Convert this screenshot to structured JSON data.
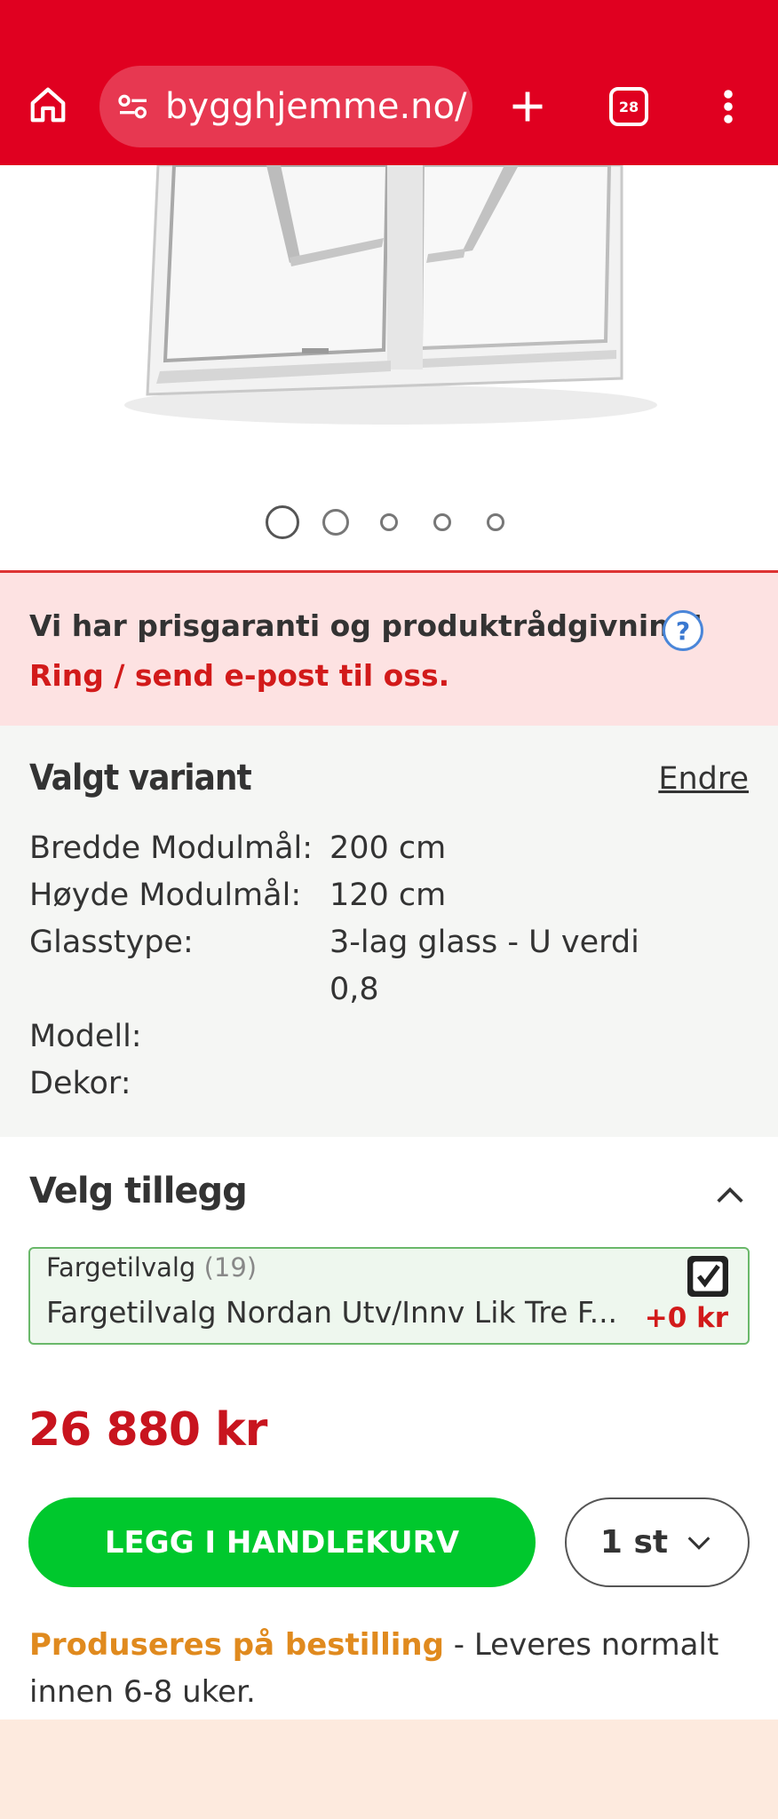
{
  "browser": {
    "url": "bygghjemme.no/",
    "tab_count": "28",
    "icons": [
      "home-icon",
      "tune-icon",
      "plus-icon",
      "tabs-icon",
      "more-vert-icon"
    ]
  },
  "carousel": {
    "total": 5,
    "active": 1
  },
  "banner": {
    "line1": "Vi har prisgaranti og produktrådgivning!",
    "line2": "Ring / send e-post til oss.",
    "help": "?"
  },
  "variant": {
    "title": "Valgt variant",
    "edit": "Endre",
    "rows": [
      {
        "label": "Bredde Modulmål:",
        "value": "200 cm"
      },
      {
        "label": "Høyde Modulmål:",
        "value": "120 cm"
      },
      {
        "label": "Glasstype:",
        "value": "3-lag glass - U verdi",
        "value2": "0,8"
      },
      {
        "label": "Modell:",
        "value": ""
      },
      {
        "label": "Dekor:",
        "value": ""
      }
    ]
  },
  "addons": {
    "title": "Velg tillegg",
    "option": {
      "category": "Fargetilvalg",
      "count": "(19)",
      "name": "Fargetilvalg Nordan Utv/Innv Lik Tre F...",
      "checked": true,
      "price": "+0 kr"
    }
  },
  "purchase": {
    "price": "26 880 kr",
    "cart_label": "LEGG I HANDLEKURV",
    "quantity": "1 st"
  },
  "availability": {
    "status": "Produseres på bestilling",
    "detail": " - Leveres normalt innen 6-8 uker."
  },
  "colors": {
    "brand_red": "#e00020",
    "cart_green": "#00c82d",
    "price_red": "#c8141e",
    "order_orange": "#e08a1e"
  }
}
